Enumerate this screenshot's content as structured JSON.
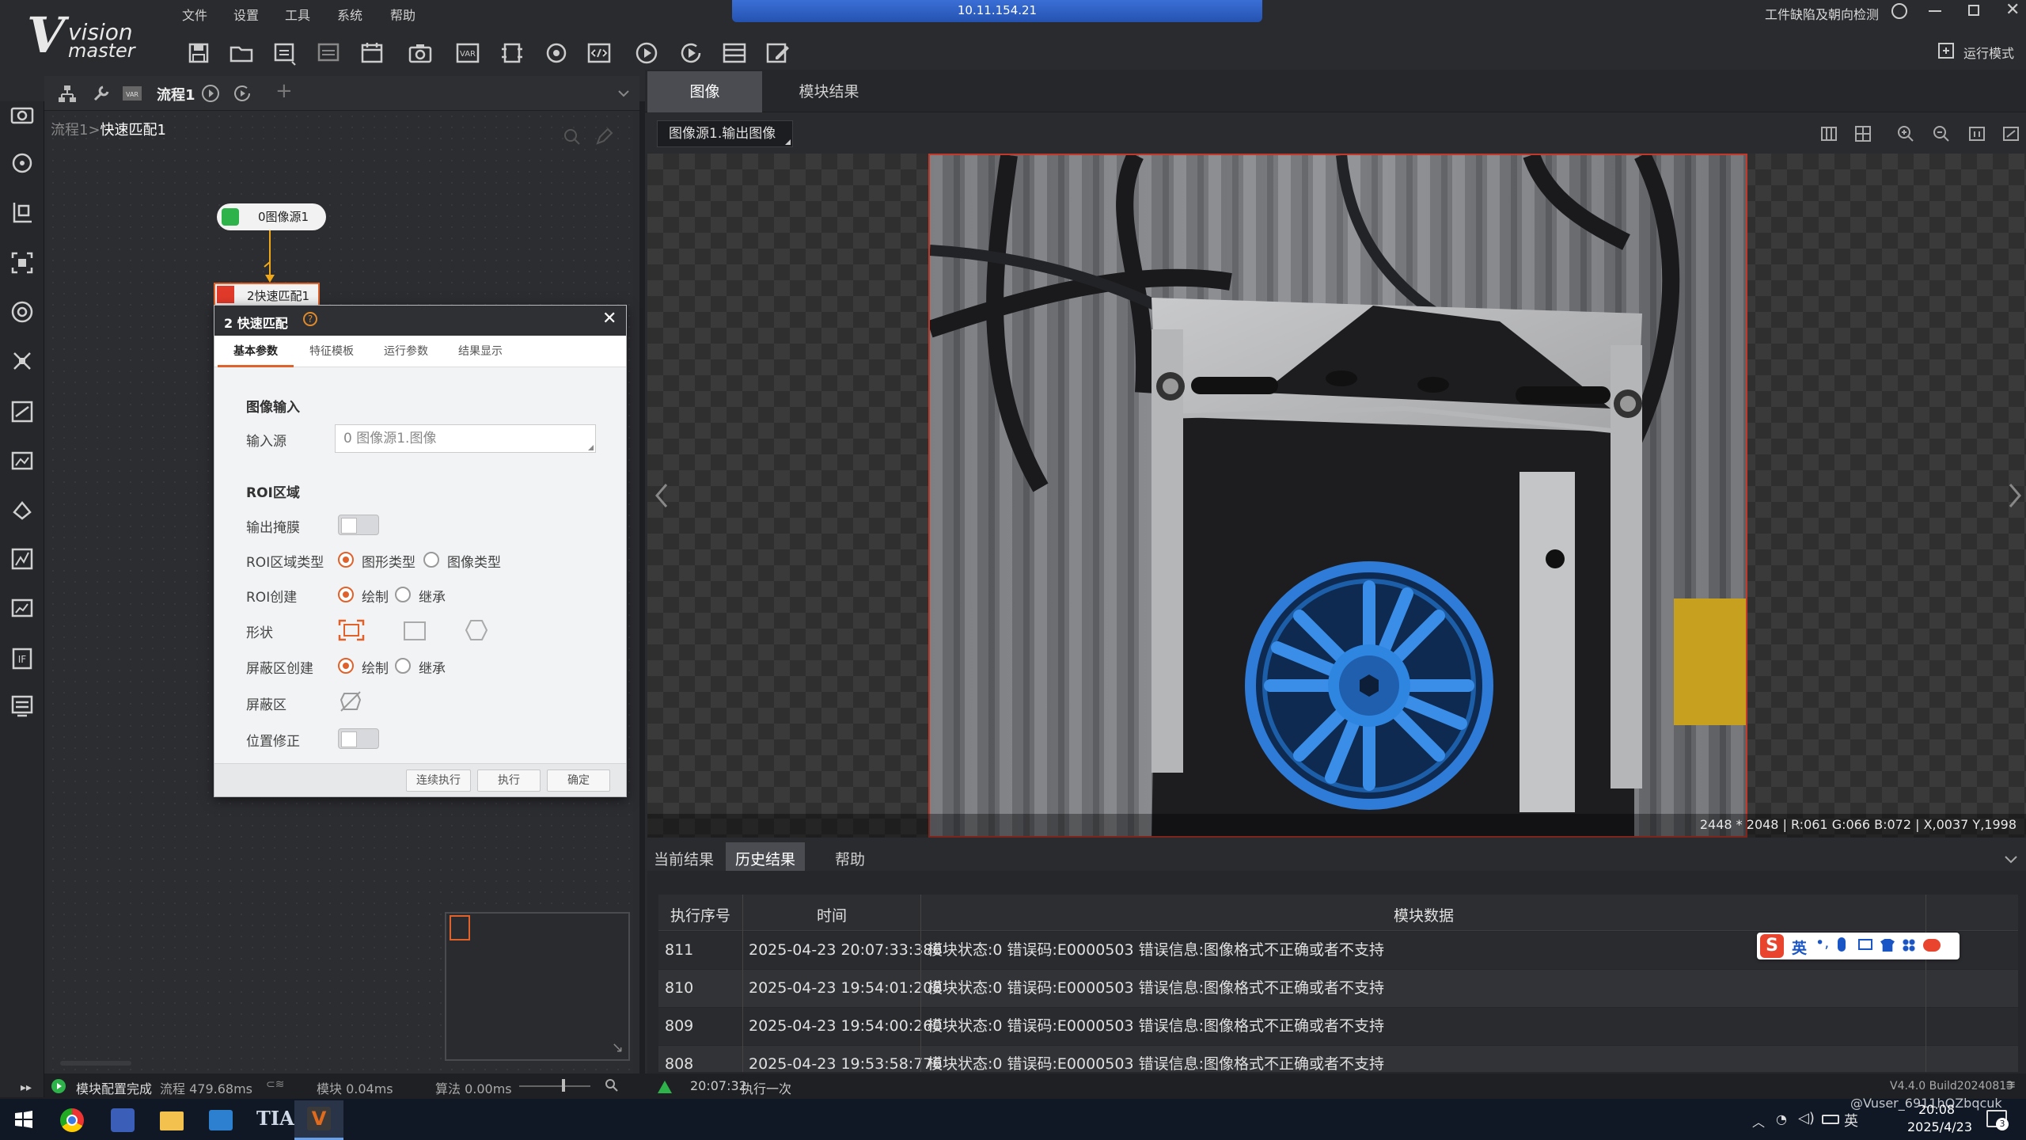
{
  "menu": {
    "file": "文件",
    "settings": "设置",
    "tools": "工具",
    "system": "系统",
    "help": "帮助"
  },
  "remote": {
    "address": "10.11.154.21"
  },
  "solution": {
    "name": "工件缺陷及朝向检测",
    "run_mode": "运行模式"
  },
  "flow": {
    "tab_label": "流程1",
    "breadcrumb_root": "流程1",
    "breadcrumb_sep": ">",
    "breadcrumb_current": "快速匹配1",
    "nodes": [
      {
        "label": "0图像源1"
      },
      {
        "label": "2快速匹配1"
      }
    ]
  },
  "dialog": {
    "title": "2 快速匹配",
    "tabs": [
      "基本参数",
      "特征模板",
      "运行参数",
      "结果显示"
    ],
    "image_input_section": "图像输入",
    "input_source_label": "输入源",
    "input_source_value": "0 图像源1.图像",
    "roi_section": "ROI区域",
    "output_mask_label": "输出掩膜",
    "roi_type_label": "ROI区域类型",
    "roi_type_options": [
      "图形类型",
      "图像类型"
    ],
    "roi_create_label": "ROI创建",
    "roi_create_options": [
      "绘制",
      "继承"
    ],
    "shape_label": "形状",
    "mask_create_label": "屏蔽区创建",
    "mask_create_options": [
      "绘制",
      "继承"
    ],
    "mask_label": "屏蔽区",
    "position_fix_label": "位置修正",
    "buttons": {
      "continuous": "连续执行",
      "run": "执行",
      "ok": "确定"
    }
  },
  "viewer": {
    "tabs": [
      "图像",
      "模块结果"
    ],
    "image_selector": "图像源1.输出图像",
    "status": "2448 * 2048  |  R:061  G:066  B:072  |  X,0037  Y,1998"
  },
  "results": {
    "tabs": [
      "当前结果",
      "历史结果",
      "帮助"
    ],
    "columns": [
      "执行序号",
      "时间",
      "模块数据"
    ],
    "rows": [
      {
        "seq": "811",
        "time": "2025-04-23 20:07:33:386",
        "data": "模块状态:0 错误码:E0000503 错误信息:图像格式不正确或者不支持"
      },
      {
        "seq": "810",
        "time": "2025-04-23 19:54:01:208",
        "data": "模块状态:0 错误码:E0000503 错误信息:图像格式不正确或者不支持"
      },
      {
        "seq": "809",
        "time": "2025-04-23 19:54:00:260",
        "data": "模块状态:0 错误码:E0000503 错误信息:图像格式不正确或者不支持"
      },
      {
        "seq": "808",
        "time": "2025-04-23 19:53:58:776",
        "data": "模块状态:0 错误码:E0000503 错误信息:图像格式不正确或者不支持"
      }
    ]
  },
  "statusbar": {
    "config_done": "模块配置完成",
    "flow_time": "流程 479.68ms",
    "module_time": "模块 0.04ms",
    "algo_time": "算法 0.00ms",
    "last_time": "20:07:32",
    "last_action": "执行一次",
    "version": "V4.4.0 Build20240813"
  },
  "ime": {
    "lang": "英"
  },
  "taskbar": {
    "watermark": "@Vuser_6911hOZbqcuk",
    "clock_time": "20:08",
    "clock_date": "2025/4/23",
    "ime": "英",
    "notif_count": "3"
  }
}
